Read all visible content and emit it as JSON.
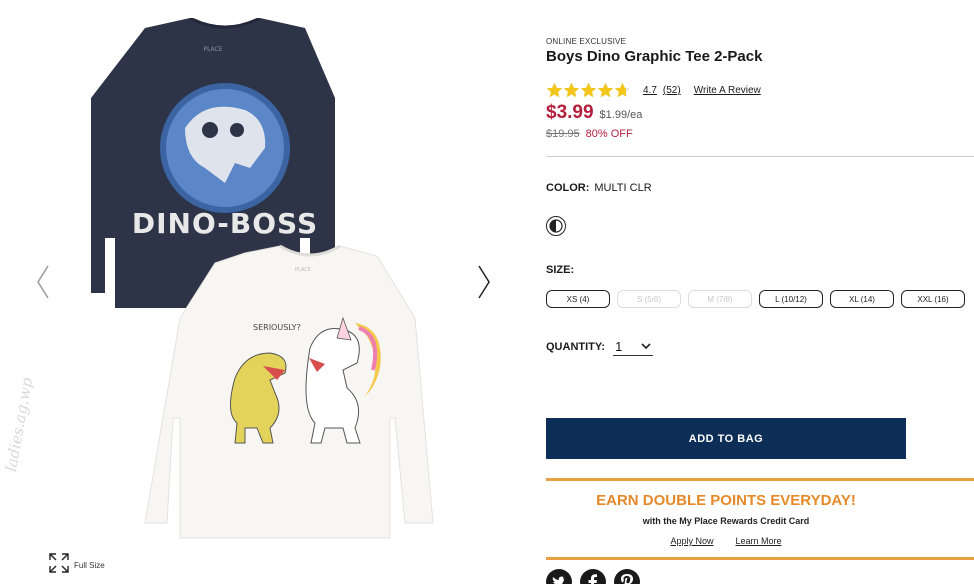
{
  "gallery": {
    "fullsize_label": "Full Size",
    "shirt_dark_text": "DINO-BOSS",
    "shirt_light_text": "SERIOUSLY?",
    "brand_tag": "PLACE",
    "watermark": "ladies.ag.wp"
  },
  "product": {
    "badge": "ONLINE EXCLUSIVE",
    "title": "Boys Dino Graphic Tee 2-Pack",
    "rating": "4.7",
    "stars": 4.7,
    "review_count": "(52)",
    "write_review": "Write A Review",
    "price": "$3.99",
    "per_each": "$1.99/ea",
    "original_price": "$19.95",
    "discount": "80% OFF"
  },
  "color": {
    "label": "COLOR:",
    "value": "MULTI CLR"
  },
  "size": {
    "label": "SIZE:",
    "options": [
      {
        "label": "XS (4)",
        "available": true
      },
      {
        "label": "S (5/6)",
        "available": false
      },
      {
        "label": "M (7/8)",
        "available": false
      },
      {
        "label": "L (10/12)",
        "available": true
      },
      {
        "label": "XL (14)",
        "available": true
      },
      {
        "label": "XXL (16)",
        "available": true
      }
    ]
  },
  "quantity": {
    "label": "QUANTITY:",
    "value": "1"
  },
  "add_to_bag": "ADD TO BAG",
  "promo": {
    "headline": "EARN DOUBLE POINTS EVERYDAY!",
    "subline": "with the My Place Rewards Credit Card",
    "apply": "Apply Now",
    "learn": "Learn More"
  },
  "colors": {
    "price_red": "#b31f3c",
    "navy": "#0d2e57",
    "promo_orange": "#e58a2b",
    "star_yellow": "#f3c61a"
  }
}
